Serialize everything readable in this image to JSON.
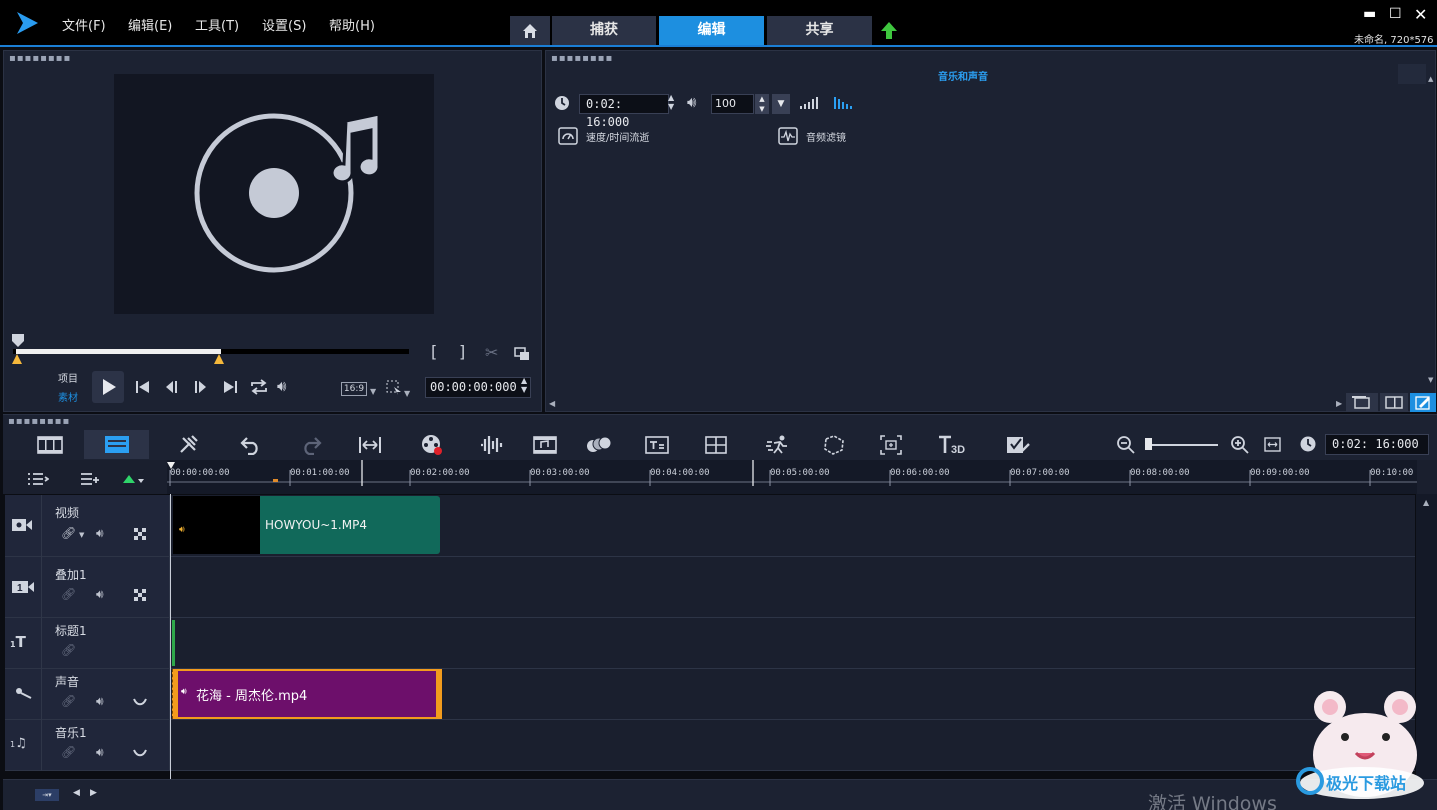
{
  "menu": {
    "items": [
      {
        "label": "文件(F)"
      },
      {
        "label": "编辑(E)"
      },
      {
        "label": "工具(T)"
      },
      {
        "label": "设置(S)"
      },
      {
        "label": "帮助(H)"
      }
    ]
  },
  "tabs": [
    {
      "label": "捕获"
    },
    {
      "label": "编辑"
    },
    {
      "label": "共享"
    }
  ],
  "project_info": "未命名, 720*576",
  "preview": {
    "project_label": "项目",
    "clip_label": "素材",
    "aspect": "16:9",
    "timecode": "00:00:00:000"
  },
  "options": {
    "section_title": "音乐和声音",
    "duration": "0:02: 16:000",
    "volume": "100",
    "speed_label": "速度/时间流逝",
    "filter_label": "音频滤镜"
  },
  "timeline": {
    "duration": "0:02: 16:000",
    "ruler": [
      "00:00:00:00",
      "00:01:00:00",
      "00:02:00:00",
      "00:03:00:00",
      "00:04:00:00",
      "00:05:00:00",
      "00:06:00:00",
      "00:07:00:00",
      "00:08:00:00",
      "00:09:00:00",
      "00:10:00"
    ],
    "tracks": [
      {
        "name": "视频"
      },
      {
        "name": "叠加1"
      },
      {
        "name": "标题1"
      },
      {
        "name": "声音"
      },
      {
        "name": "音乐1"
      }
    ],
    "video_clip": "HOWYOU~1.MP4",
    "audio_clip": "花海 - 周杰伦.mp4"
  },
  "watermark": "激活 Windows",
  "badge_text": "极光下载站",
  "colors": {
    "accent": "#1d8fe0",
    "video_clip": "#11695a",
    "audio_clip": "#6d0f6b",
    "audio_border": "#f29b1d"
  }
}
